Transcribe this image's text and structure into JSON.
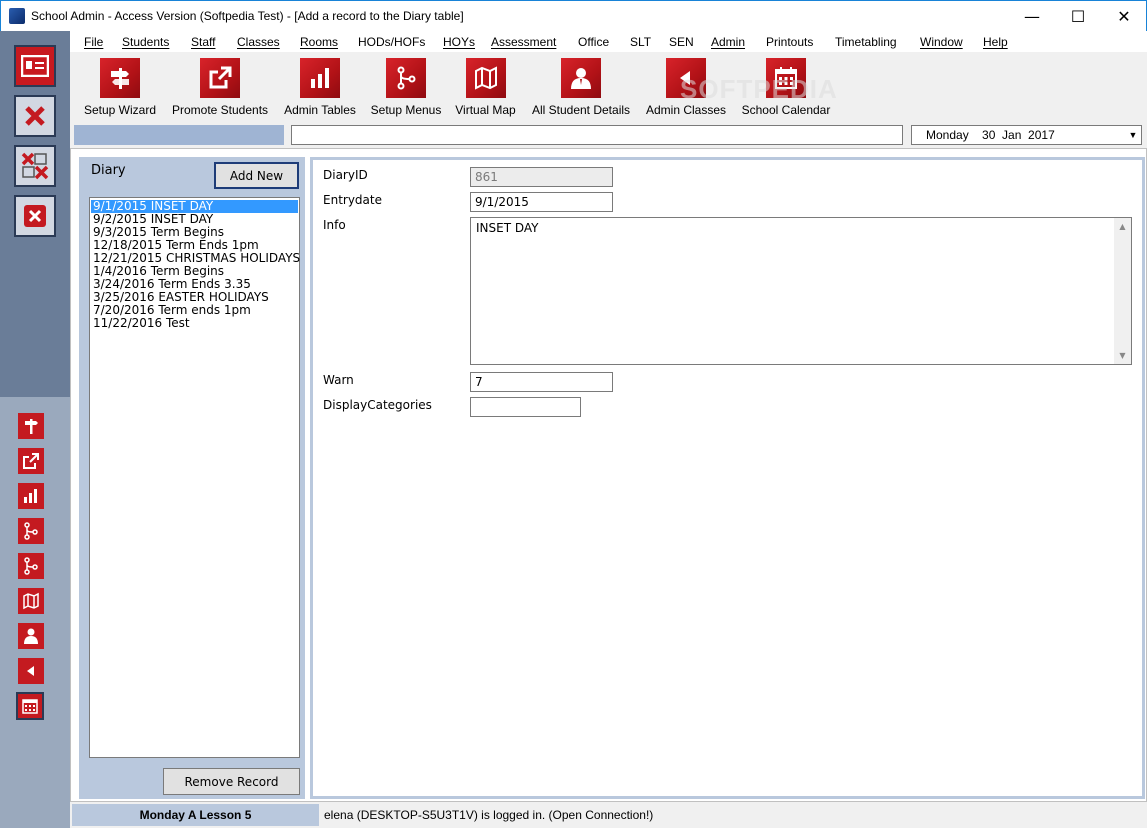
{
  "window": {
    "title": "School Admin - Access Version (Softpedia Test) - [Add a record to the Diary table]",
    "min_glyph": "—",
    "max_glyph": "☐",
    "close_glyph": "✕"
  },
  "menu": [
    "File",
    "Students",
    "Staff",
    "Classes",
    "Rooms",
    "HODs/HOFs",
    "HOYs",
    "Assessment",
    "Office",
    "SLT",
    "SEN",
    "Admin",
    "Printouts",
    "Timetabling",
    "Window",
    "Help"
  ],
  "toolbar": [
    {
      "label": "Setup Wizard",
      "icon": "signpost-icon"
    },
    {
      "label": "Promote Students",
      "icon": "external-link-icon"
    },
    {
      "label": "Admin Tables",
      "icon": "bar-chart-icon"
    },
    {
      "label": "Setup Menus",
      "icon": "branch-icon"
    },
    {
      "label": "Virtual Map",
      "icon": "map-icon"
    },
    {
      "label": "All Student Details",
      "icon": "person-icon"
    },
    {
      "label": "Admin Classes",
      "icon": "back-arrow-icon"
    },
    {
      "label": "School Calendar",
      "icon": "calendar-icon"
    }
  ],
  "watermark": "SOFTPEDIA",
  "nav": {
    "date_value": "Monday    30  Jan  2017",
    "date_arrow": "▼"
  },
  "diary": {
    "title": "Diary",
    "add_new_label": "Add New",
    "remove_label": "Remove Record",
    "items": [
      "9/1/2015 INSET DAY",
      "9/2/2015 INSET DAY",
      "9/3/2015 Term Begins",
      "12/18/2015 Term Ends 1pm",
      "12/21/2015 CHRISTMAS HOLIDAYS",
      "1/4/2016 Term Begins",
      "3/24/2016 Term Ends 3.35",
      "3/25/2016 EASTER HOLIDAYS",
      "7/20/2016 Term ends 1pm",
      "11/22/2016 Test"
    ],
    "selected_index": 0
  },
  "record": {
    "diaryid_label": "DiaryID",
    "diaryid_value": "861",
    "entrydate_label": "Entrydate",
    "entrydate_value": "9/1/2015",
    "info_label": "Info",
    "info_value": "INSET DAY",
    "warn_label": "Warn",
    "warn_value": "7",
    "displaycategories_label": "DisplayCategories",
    "displaycategories_value": ""
  },
  "status": {
    "lesson": "Monday A Lesson 5",
    "login": "elena (DESKTOP-S5U3T1V) is logged in. (Open Connection!)"
  }
}
